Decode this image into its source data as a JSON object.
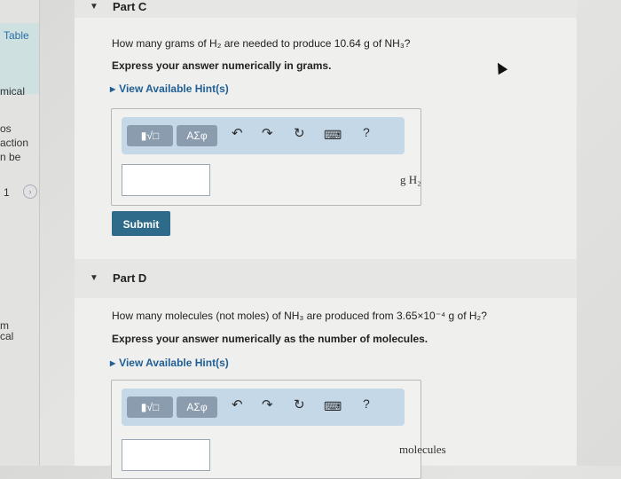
{
  "sidebar": {
    "table_link": "Table",
    "chemical": "mical",
    "os": "os",
    "action": "action",
    "be": "n be",
    "page_num": "1",
    "m": "m",
    "cal": "cal"
  },
  "partC": {
    "title": "Part C",
    "question": "How many grams of H₂ are needed to produce 10.64 g of NH₃?",
    "instruction": "Express your answer numerically in grams.",
    "hint": "View Available Hint(s)",
    "toolbar": {
      "templates": "▮√□",
      "greek": "ΑΣφ",
      "help": "?"
    },
    "input_value": "",
    "unit": "g H₂",
    "submit": "Submit"
  },
  "partD": {
    "title": "Part D",
    "question": "How many molecules (not moles) of NH₃ are produced from 3.65×10⁻⁴ g of H₂?",
    "instruction": "Express your answer numerically as the number of molecules.",
    "hint": "View Available Hint(s)",
    "toolbar": {
      "templates": "▮√□",
      "greek": "ΑΣφ",
      "help": "?"
    },
    "input_value": "",
    "unit": "molecules"
  },
  "icons": [
    "undo-icon",
    "redo-icon",
    "reset-icon",
    "keyboard-icon",
    "help-icon"
  ]
}
